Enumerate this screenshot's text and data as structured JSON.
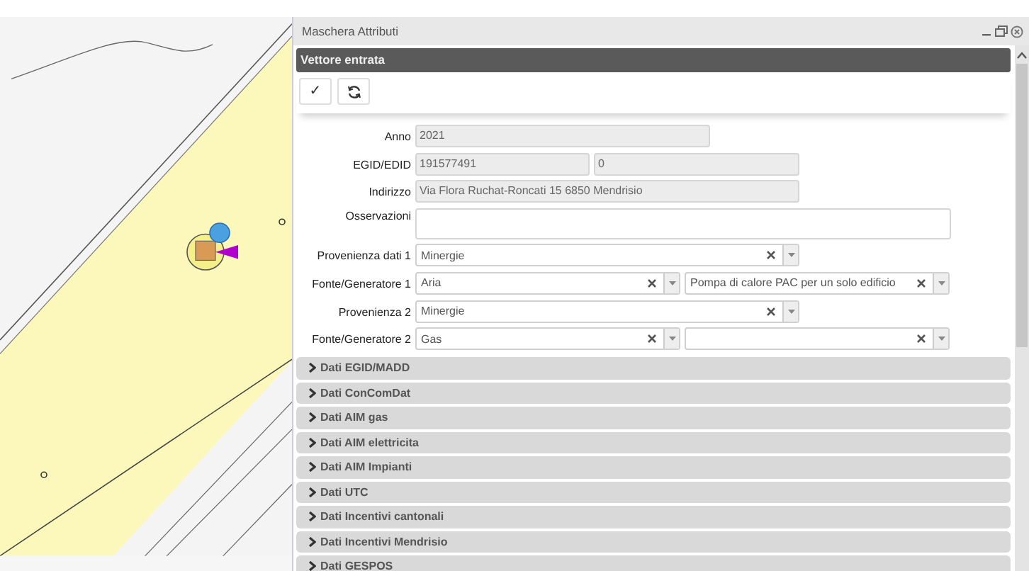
{
  "window": {
    "title": "Maschera Attributi"
  },
  "header": "Vettore entrata",
  "toolbar": [
    {
      "kind": "char",
      "label": "✓"
    },
    {
      "kind": "refresh"
    }
  ],
  "form": [
    {
      "label": "Anno",
      "kind": "half",
      "fields": [
        {
          "kind": "text",
          "value": "2021",
          "readonly": true
        }
      ]
    },
    {
      "label": "EGID/EDID",
      "kind": "pair",
      "fields": [
        {
          "kind": "text",
          "value": "191577491",
          "readonly": true
        },
        {
          "kind": "text",
          "value": "0",
          "readonly": true
        }
      ]
    },
    {
      "label": "Indirizzo",
      "kind": "medium",
      "fields": [
        {
          "kind": "text",
          "value": "Via Flora Ruchat-Roncati 15 6850 Mendrisio",
          "readonly": true
        }
      ]
    },
    {
      "label": "Osservazioni",
      "kind": "area",
      "fields": [
        {
          "kind": "area",
          "readonly": false
        }
      ]
    },
    {
      "label": "Provenienza dati 1",
      "kind": "medium",
      "fields": [
        {
          "kind": "select",
          "value": "Minergie"
        }
      ]
    },
    {
      "label": "Fonte/Generatore 1",
      "kind": "widepair",
      "fields": [
        {
          "kind": "select",
          "value": "Aria"
        },
        {
          "kind": "select",
          "value": "Pompa di calore PAC per un solo edificio"
        }
      ]
    },
    {
      "label": "Provenienza 2",
      "kind": "medium",
      "fields": [
        {
          "kind": "select",
          "value": "Minergie"
        }
      ]
    },
    {
      "label": "Fonte/Generatore 2",
      "kind": "widepair",
      "fields": [
        {
          "kind": "select",
          "value": "Gas"
        },
        {
          "kind": "select"
        }
      ]
    }
  ],
  "sections": [
    {
      "label": "Dati EGID/MADD",
      "expanded": false
    },
    {
      "label": "Dati ConComDat",
      "expanded": false
    },
    {
      "label": "Dati AIM gas",
      "expanded": false
    },
    {
      "label": "Dati AIM elettricita",
      "expanded": false
    },
    {
      "label": "Dati AIM Impianti",
      "expanded": false
    },
    {
      "label": "Dati UTC",
      "expanded": false
    },
    {
      "label": "Dati Incentivi cantonali",
      "expanded": false
    },
    {
      "label": "Dati Incentivi Mendrisio",
      "expanded": false
    },
    {
      "label": "Dati GESPOS",
      "expanded": false
    }
  ]
}
